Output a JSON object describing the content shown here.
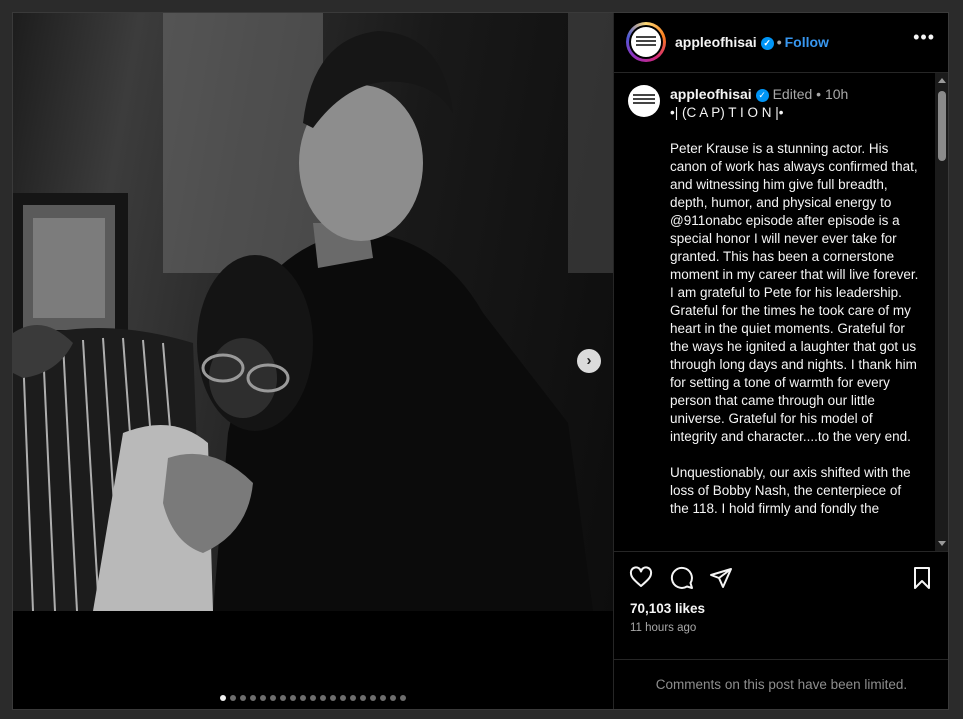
{
  "post": {
    "username": "appleofhisai",
    "separator": "•",
    "follow_label": "Follow",
    "more_icon": "more-options-icon",
    "next_icon": "chevron-right-icon",
    "carousel_total": 19,
    "carousel_current": 1
  },
  "caption": {
    "username": "appleofhisai",
    "edited": "Edited",
    "time": "10h",
    "text": "•| (C A P) T I O N |•\n\nPeter Krause is a stunning actor. His canon of work has always confirmed that, and witnessing him give full breadth, depth, humor, and physical energy to @911onabc episode after episode is a special honor I will never ever take for granted. This has been a cornerstone moment in my career that will live forever. I am grateful to Pete for his leadership. Grateful for the times he took care of my heart in the quiet moments. Grateful for the ways he ignited a laughter that got us through long days and nights. I thank him for setting a tone of warmth for every person that came through our little universe. Grateful for his model of integrity and character....to the very end.\n\nUnquestionably, our axis shifted with the loss of Bobby Nash, the centerpiece of the 118. I hold firmly and fondly the"
  },
  "engagement": {
    "likes": "70,103 likes",
    "time_ago": "11 hours ago",
    "icons": [
      "heart-icon",
      "comment-icon",
      "share-icon",
      "bookmark-icon"
    ]
  },
  "footer": {
    "limited_text": "Comments on this post have been limited."
  },
  "colors": {
    "background": "#000000",
    "accent": "#3897f0",
    "verified": "#0095f6",
    "muted": "#a8a8a8"
  }
}
